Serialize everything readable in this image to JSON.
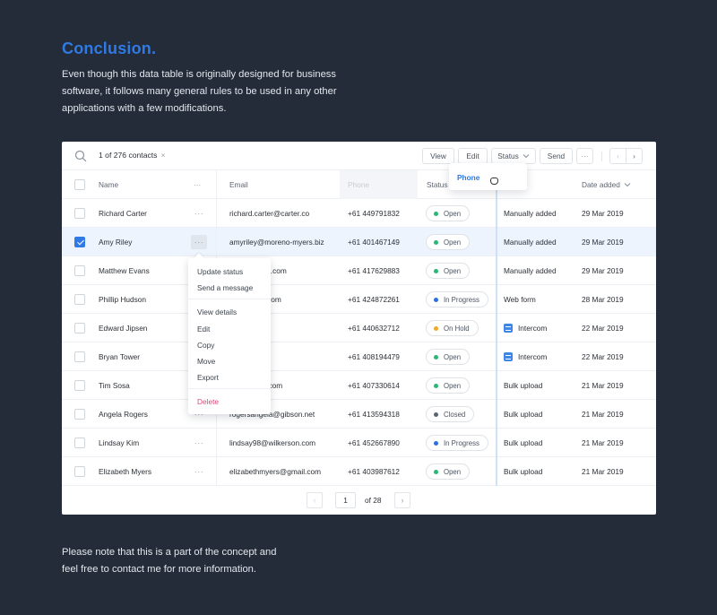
{
  "intro": {
    "title": "Conclusion.",
    "body": "Even though this data table is originally designed for business software, it follows many general rules to be used in any other applications with a few modifications."
  },
  "outro": {
    "body": "Please note that this is a part of the concept and feel free to contact me for more information."
  },
  "toolbar": {
    "search_icon": "search-icon",
    "selection_count": "1 of 276 contacts",
    "clear_selection": "×",
    "buttons": {
      "view": "View",
      "edit": "Edit",
      "status": "Status",
      "send": "Send",
      "more": "···"
    },
    "prev": "‹",
    "next": "›"
  },
  "columns": {
    "name": "Name",
    "name_menu": "···",
    "email": "Email",
    "phone": "Phone",
    "status": "Status",
    "date_added": "Date added"
  },
  "drag_popover": {
    "label": "Phone"
  },
  "rows": [
    {
      "name": "Richard Carter",
      "email": "richard.carter@carter.co",
      "phone": "+61 449791832",
      "status": "Open",
      "source": "Manually added",
      "date": "29 Mar 2019",
      "checked": false
    },
    {
      "name": "Amy Riley",
      "email": "amyriley@moreno-myers.biz",
      "phone": "+61 401467149",
      "status": "Open",
      "source": "Manually added",
      "date": "29 Mar 2019",
      "checked": true
    },
    {
      "name": "Matthew Evans",
      "email": "ew@holmes.com",
      "phone": "+61 417629883",
      "status": "Open",
      "source": "Manually added",
      "date": "29 Mar 2019",
      "checked": false
    },
    {
      "name": "Phillip Hudson",
      "email": "n@hotmail.com",
      "phone": "+61 424872261",
      "status": "In Progress",
      "source": "Web form",
      "date": "28 Mar 2019",
      "checked": false
    },
    {
      "name": "Edward Jipsen",
      "email": "nline.net",
      "phone": "+61 440632712",
      "status": "On Hold",
      "source": "Intercom",
      "date": "22 Mar 2019",
      "checked": false
    },
    {
      "name": "Bryan Tower",
      "email": "cglobal.net",
      "phone": "+61 408194479",
      "status": "Open",
      "source": "Intercom",
      "date": "22 Mar 2019",
      "checked": false
    },
    {
      "name": "Tim Sosa",
      "email": "@swanson.com",
      "phone": "+61 407330614",
      "status": "Open",
      "source": "Bulk upload",
      "date": "21 Mar 2019",
      "checked": false
    },
    {
      "name": "Angela Rogers",
      "email": "rogersangela@gibson.net",
      "phone": "+61 413594318",
      "status": "Closed",
      "source": "Bulk upload",
      "date": "21 Mar 2019",
      "checked": false
    },
    {
      "name": "Lindsay Kim",
      "email": "lindsay98@wilkerson.com",
      "phone": "+61 452667890",
      "status": "In Progress",
      "source": "Bulk upload",
      "date": "21 Mar 2019",
      "checked": false
    },
    {
      "name": "Elizabeth Myers",
      "email": "elizabethmyers@gmail.com",
      "phone": "+61 403987612",
      "status": "Open",
      "source": "Bulk upload",
      "date": "21 Mar 2019",
      "checked": false
    }
  ],
  "row_menu": "···",
  "status_colors": {
    "Open": "#2bb673",
    "In Progress": "#2f6fde",
    "On Hold": "#f0a928",
    "Closed": "#5b6472"
  },
  "context_menu": {
    "items": [
      "Update status",
      "Send a message",
      "View details",
      "Edit",
      "Copy",
      "Move",
      "Export",
      "Delete"
    ]
  },
  "pagination": {
    "prev": "‹",
    "current_page": "1",
    "of_label": "of 28",
    "next": "›"
  },
  "colors": {
    "background": "#232c38",
    "accent": "#2f7ae5",
    "danger": "#e0457b"
  }
}
